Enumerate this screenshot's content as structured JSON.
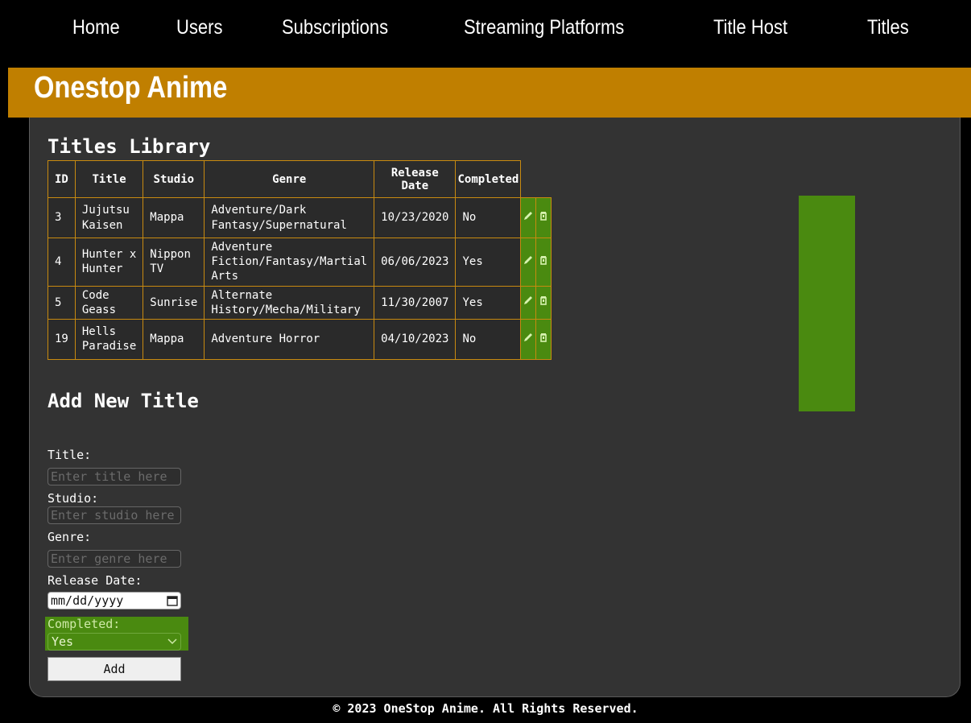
{
  "nav": {
    "items": [
      "Home",
      "Users",
      "Subscriptions",
      "Streaming Platforms",
      "Title Host",
      "Titles"
    ]
  },
  "site": {
    "title": "Onestop Anime"
  },
  "library": {
    "heading": "Titles Library",
    "columns": [
      "ID",
      "Title",
      "Studio",
      "Genre",
      "Release Date",
      "Completed"
    ],
    "rows": [
      {
        "id": "3",
        "title": "Jujutsu Kaisen",
        "studio": "Mappa",
        "genre": "Adventure/Dark Fantasy/Supernatural",
        "release_date": "10/23/2020",
        "completed": "No"
      },
      {
        "id": "4",
        "title": "Hunter x Hunter",
        "studio": "Nippon TV",
        "genre": "Adventure Fiction/Fantasy/Martial Arts",
        "release_date": "06/06/2023",
        "completed": "Yes"
      },
      {
        "id": "5",
        "title": "Code Geass",
        "studio": "Sunrise",
        "genre": "Alternate History/Mecha/Military",
        "release_date": "11/30/2007",
        "completed": "Yes"
      },
      {
        "id": "19",
        "title": "Hells Paradise",
        "studio": "Mappa",
        "genre": "Adventure Horror",
        "release_date": "04/10/2023",
        "completed": "No"
      }
    ],
    "action_icons": [
      "pencil-icon",
      "trash-icon"
    ]
  },
  "form": {
    "heading": "Add New Title",
    "title_label": "Title:",
    "title_placeholder": "Enter title here",
    "studio_label": "Studio:",
    "studio_placeholder": "Enter studio here",
    "genre_label": "Genre:",
    "genre_placeholder": "Enter genre here",
    "release_label": "Release Date:",
    "release_placeholder": "mm/dd/yyyy",
    "completed_label": "Completed:",
    "completed_value": "Yes",
    "add_label": "Add"
  },
  "footer": {
    "text": "© 2023 OneStop Anime. All Rights Reserved."
  },
  "colors": {
    "banner": "#c07f00",
    "table_border": "#c88a10",
    "highlight": "#4a8a10"
  }
}
